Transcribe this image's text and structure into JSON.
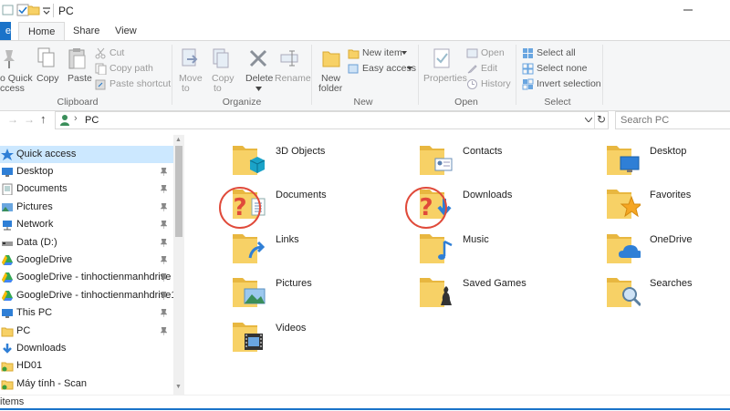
{
  "window": {
    "title": "PC"
  },
  "tabs": {
    "file": "e",
    "home": "Home",
    "share": "Share",
    "view": "View"
  },
  "ribbon": {
    "clipboard": {
      "pin_quick_access": "o Quick",
      "pin_quick_access2": "ccess",
      "copy": "Copy",
      "paste": "Paste",
      "cut": "Cut",
      "copy_path": "Copy path",
      "paste_shortcut": "Paste shortcut",
      "group": "Clipboard"
    },
    "organize": {
      "move_to": "Move",
      "move_to2": "to",
      "copy_to": "Copy",
      "copy_to2": "to",
      "delete": "Delete",
      "rename": "Rename",
      "group": "Organize"
    },
    "new": {
      "new_folder": "New",
      "new_folder2": "folder",
      "new_item": "New item",
      "easy_access": "Easy access",
      "group": "New"
    },
    "open": {
      "properties": "Properties",
      "open": "Open",
      "edit": "Edit",
      "history": "History",
      "group": "Open"
    },
    "select": {
      "select_all": "Select all",
      "select_none": "Select none",
      "invert": "Invert selection",
      "group": "Select"
    }
  },
  "address": {
    "path": "PC",
    "search_placeholder": "Search PC"
  },
  "nav": {
    "quick_access": "Quick access",
    "items": [
      {
        "label": "Desktop",
        "pinned": true
      },
      {
        "label": "Documents",
        "pinned": true
      },
      {
        "label": "Pictures",
        "pinned": true
      },
      {
        "label": "Network",
        "pinned": true
      },
      {
        "label": "Data (D:)",
        "pinned": true
      },
      {
        "label": "GoogleDrive",
        "pinned": true
      },
      {
        "label": "GoogleDrive - tinhoctienmanhdrive",
        "pinned": true
      },
      {
        "label": "GoogleDrive - tinhoctienmanhdrive1",
        "pinned": true
      },
      {
        "label": "This PC",
        "pinned": true
      },
      {
        "label": "PC",
        "pinned": true
      },
      {
        "label": "Downloads",
        "pinned": false
      },
      {
        "label": "HD01",
        "pinned": false
      },
      {
        "label": "Máy tính - Scan",
        "pinned": false
      }
    ]
  },
  "folders": [
    {
      "name": "3D Objects",
      "icon": "3d-cube-icon"
    },
    {
      "name": "Contacts",
      "icon": "contact-card-icon"
    },
    {
      "name": "Desktop",
      "icon": "monitor-icon"
    },
    {
      "name": "Documents",
      "icon": "document-icon"
    },
    {
      "name": "Downloads",
      "icon": "download-arrow-icon"
    },
    {
      "name": "Favorites",
      "icon": "star-icon"
    },
    {
      "name": "Links",
      "icon": "link-arrow-icon"
    },
    {
      "name": "Music",
      "icon": "music-note-icon"
    },
    {
      "name": "OneDrive",
      "icon": "cloud-icon"
    },
    {
      "name": "Pictures",
      "icon": "picture-icon"
    },
    {
      "name": "Saved Games",
      "icon": "chess-piece-icon"
    },
    {
      "name": "Searches",
      "icon": "magnifier-icon"
    },
    {
      "name": "Videos",
      "icon": "film-icon"
    }
  ],
  "status": {
    "text": "items"
  },
  "colors": {
    "accent": "#1a73c9",
    "folder": "#f7d166",
    "annotation": "#e04a3a"
  }
}
